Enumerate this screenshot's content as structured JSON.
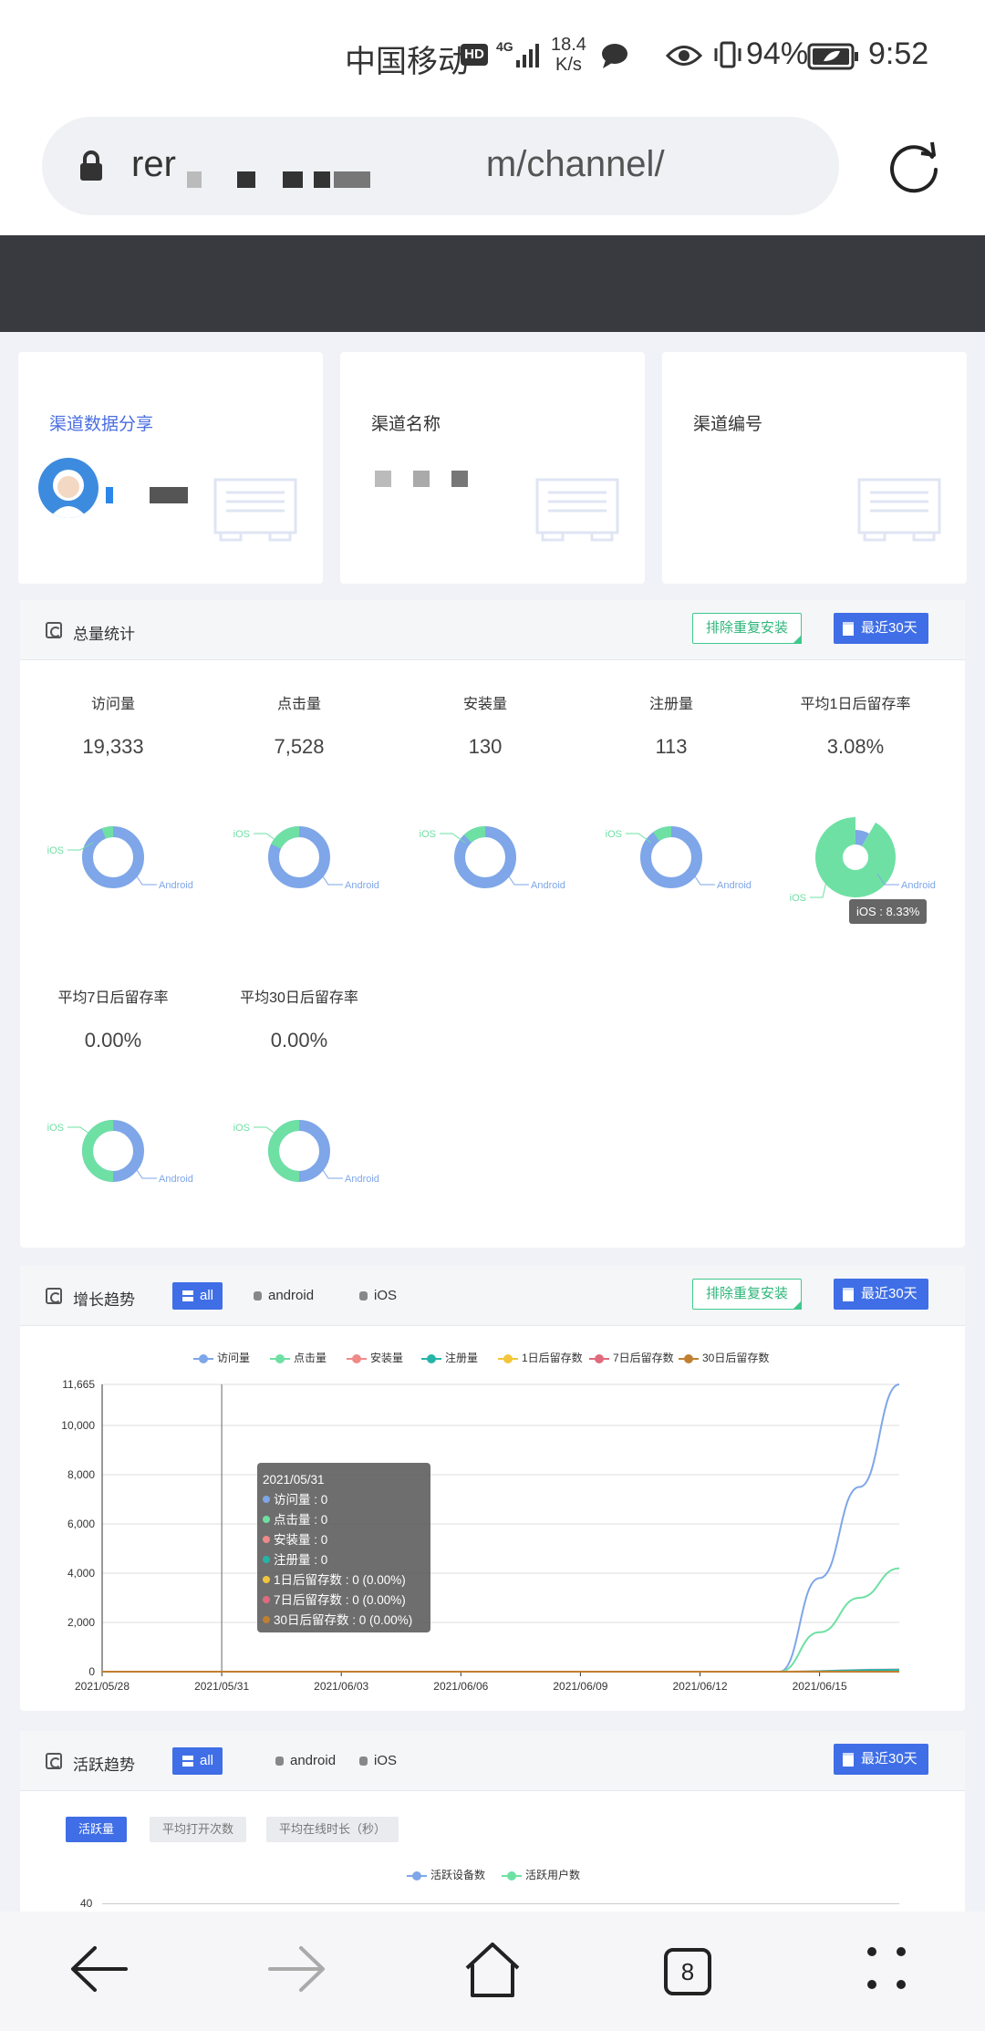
{
  "status_bar": {
    "carrier": "中国移动",
    "hd": "HD",
    "network": "4G",
    "speed_value": "18.4",
    "speed_unit": "K/s",
    "battery": "94%",
    "time": "9:52"
  },
  "browser": {
    "url_prefix": "rer",
    "url_suffix": "m/channel/",
    "tab_count": "8"
  },
  "info_cards": [
    {
      "title": "渠道数据分享"
    },
    {
      "title": "渠道名称"
    },
    {
      "title": "渠道编号"
    }
  ],
  "totals_panel": {
    "title": "总量统计",
    "dedupe_button": "排除重复安装",
    "range_button": "最近30天",
    "stats": [
      {
        "label": "访问量",
        "value": "19,333",
        "ios_share": 0.06,
        "style": "donut"
      },
      {
        "label": "点击量",
        "value": "7,528",
        "ios_share": 0.18,
        "style": "donut"
      },
      {
        "label": "安装量",
        "value": "130",
        "ios_share": 0.12,
        "style": "donut"
      },
      {
        "label": "注册量",
        "value": "113",
        "ios_share": 0.1,
        "style": "donut"
      },
      {
        "label": "平均1日后留存率",
        "value": "3.08%",
        "ios_share": 0.9167,
        "style": "rose"
      },
      {
        "label": "平均7日后留存率",
        "value": "0.00%",
        "ios_share": 0.5,
        "style": "donut"
      },
      {
        "label": "平均30日后留存率",
        "value": "0.00%",
        "ios_share": 0.5,
        "style": "donut"
      }
    ],
    "label_ios": "iOS",
    "label_android": "Android",
    "tooltip": "iOS : 8.33%"
  },
  "growth_panel": {
    "title": "增长趋势",
    "tabs": [
      "all",
      "android",
      "iOS"
    ],
    "dedupe_button": "排除重复安装",
    "range_button": "最近30天"
  },
  "chart_data": {
    "type": "line",
    "x": [
      "2021/05/28",
      "2021/05/31",
      "2021/06/03",
      "2021/06/06",
      "2021/06/09",
      "2021/06/12",
      "2021/06/15"
    ],
    "ylim": [
      0,
      11665
    ],
    "y_ticks": [
      "11,665",
      "10,000",
      "8,000",
      "6,000",
      "4,000",
      "2,000",
      "0"
    ],
    "legend": [
      "访问量",
      "点击量",
      "安装量",
      "注册量",
      "1日后留存数",
      "7日后留存数",
      "30日后留存数"
    ],
    "colors": [
      "#7ea6e8",
      "#6ee0a4",
      "#f08a88",
      "#27b4a8",
      "#f3c53a",
      "#e06a7e",
      "#c08030"
    ],
    "series": [
      {
        "name": "访问量",
        "points": [
          [
            "2021/06/14",
            0
          ],
          [
            "2021/06/15",
            3800
          ],
          [
            "2021/06/16",
            7500
          ],
          [
            "2021/06/17",
            11665
          ]
        ]
      },
      {
        "name": "点击量",
        "points": [
          [
            "2021/06/14",
            0
          ],
          [
            "2021/06/15",
            1600
          ],
          [
            "2021/06/16",
            3000
          ],
          [
            "2021/06/17",
            4200
          ]
        ]
      },
      {
        "name": "安装量",
        "points": [
          [
            "2021/06/14",
            0
          ],
          [
            "2021/06/17",
            90
          ]
        ]
      },
      {
        "name": "注册量",
        "points": [
          [
            "2021/06/14",
            0
          ],
          [
            "2021/06/17",
            80
          ]
        ]
      },
      {
        "name": "1日后留存数",
        "points": [
          [
            "2021/05/28",
            0
          ],
          [
            "2021/06/17",
            0
          ]
        ]
      },
      {
        "name": "7日后留存数",
        "points": [
          [
            "2021/05/28",
            0
          ],
          [
            "2021/06/17",
            0
          ]
        ]
      },
      {
        "name": "30日后留存数",
        "points": [
          [
            "2021/05/28",
            0
          ],
          [
            "2021/06/17",
            0
          ]
        ]
      }
    ],
    "tooltip": {
      "date": "2021/05/31",
      "rows": [
        "访问量 : 0",
        "点击量 : 0",
        "安装量 : 0",
        "注册量 : 0",
        "1日后留存数 : 0 (0.00%)",
        "7日后留存数 : 0 (0.00%)",
        "30日后留存数 : 0 (0.00%)"
      ]
    }
  },
  "active_panel": {
    "title": "活跃趋势",
    "tabs": [
      "all",
      "android",
      "iOS"
    ],
    "range_button": "最近30天",
    "subtabs": [
      "活跃量",
      "平均打开次数",
      "平均在线时长（秒）"
    ],
    "legend": [
      "活跃设备数",
      "活跃用户数"
    ],
    "y_top": "40"
  }
}
